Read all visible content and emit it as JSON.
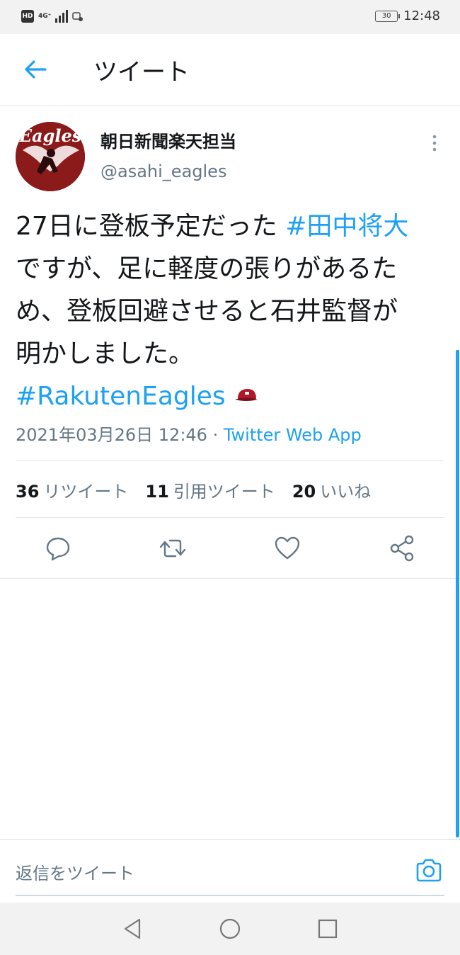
{
  "status_bar": {
    "hd_label": "HD",
    "network_label": "4G⁺",
    "battery_level": "30",
    "time": "12:48"
  },
  "header": {
    "title": "ツイート",
    "back_icon": "arrow-left-icon"
  },
  "tweet": {
    "display_name": "朝日新聞楽天担当",
    "handle": "@asahi_eagles",
    "avatar_text": "Eagles",
    "text_before": "27日に登板予定だった ",
    "hashtag_1": "#田中将大",
    "text_middle": " ですが、足に軽度の張りがあるため、登板回避させると石井監督が明かしました。",
    "hashtag_2": "#RakutenEagles",
    "emoji": "baseball-cap-icon",
    "timestamp": "2021年03月26日 12:46",
    "separator": " · ",
    "source_app": "Twitter Web App"
  },
  "stats": {
    "retweets_count": "36",
    "retweets_label": "リツイート",
    "quotes_count": "11",
    "quotes_label": "引用ツイート",
    "likes_count": "20",
    "likes_label": "いいね"
  },
  "actions": [
    "reply-icon",
    "retweet-icon",
    "like-icon",
    "share-icon"
  ],
  "reply_bar": {
    "placeholder": "返信をツイート",
    "camera_icon": "camera-icon"
  },
  "colors": {
    "accent": "#1da1f2",
    "text": "#14171a",
    "secondary": "#657786",
    "avatar_bg": "#8b1a1a"
  }
}
